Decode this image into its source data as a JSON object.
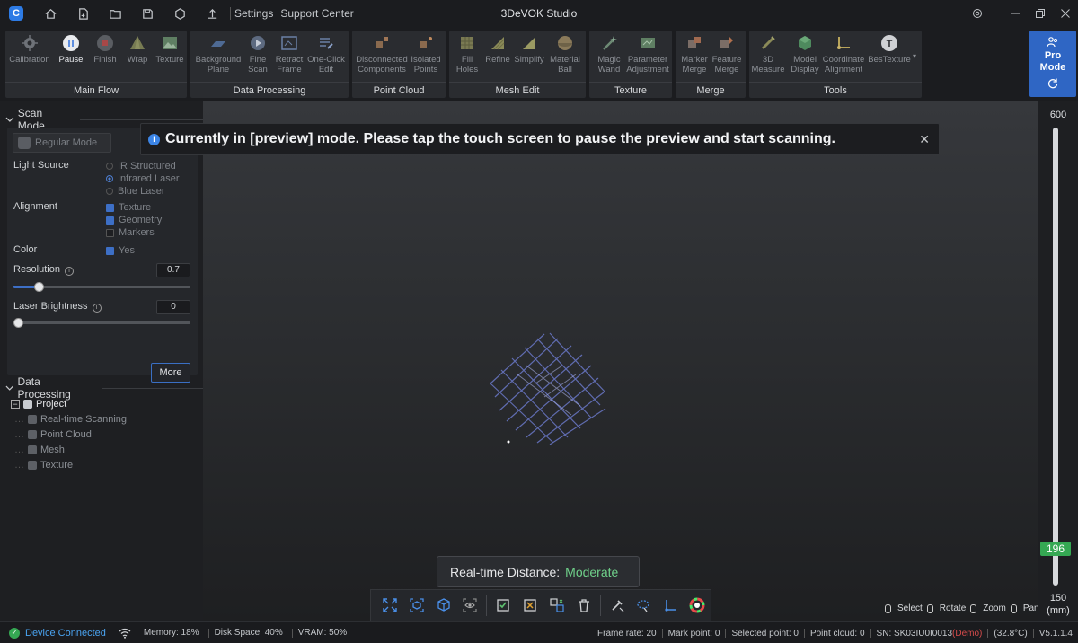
{
  "titlebar": {
    "logo_letter": "C",
    "links": [
      "Settings",
      "Support Center"
    ],
    "app_title": "3DeVOK Studio"
  },
  "ribbon": {
    "groups": [
      {
        "label": "Main Flow",
        "tools": [
          {
            "label": "Calibration",
            "icon": "calibration-icon",
            "active": false
          },
          {
            "label": "Pause",
            "icon": "pause-icon",
            "active": true
          },
          {
            "label": "Finish",
            "icon": "stop-icon",
            "active": false
          },
          {
            "label": "Wrap",
            "icon": "wrap-icon",
            "active": false
          },
          {
            "label": "Texture",
            "icon": "image-icon",
            "active": false
          }
        ]
      },
      {
        "label": "Data Processing",
        "tools": [
          {
            "label": "Background Plane",
            "icon": "plane-icon"
          },
          {
            "label": "Fine Scan",
            "icon": "play-scan-icon"
          },
          {
            "label": "Retract Frame",
            "icon": "frame-icon"
          },
          {
            "label": "One-Click Edit",
            "icon": "edit-list-icon"
          }
        ]
      },
      {
        "label": "Point Cloud",
        "tools": [
          {
            "label": "Disconnected Components",
            "icon": "components-icon"
          },
          {
            "label": "Isolated Points",
            "icon": "isolated-points-icon"
          }
        ]
      },
      {
        "label": "Mesh Edit",
        "tools": [
          {
            "label": "Fill Holes",
            "icon": "fill-holes-icon"
          },
          {
            "label": "Refine",
            "icon": "refine-icon"
          },
          {
            "label": "Simplify",
            "icon": "simplify-icon"
          },
          {
            "label": "Material Ball",
            "icon": "material-ball-icon"
          }
        ]
      },
      {
        "label": "Texture",
        "tools": [
          {
            "label": "Magic Wand",
            "icon": "magic-wand-icon"
          },
          {
            "label": "Parameter Adjustment",
            "icon": "parameter-icon"
          }
        ]
      },
      {
        "label": "Merge",
        "tools": [
          {
            "label": "Marker Merge",
            "icon": "marker-merge-icon"
          },
          {
            "label": "Feature Merge",
            "icon": "feature-merge-icon"
          }
        ]
      },
      {
        "label": "Tools",
        "tools": [
          {
            "label": "3D Measure",
            "icon": "measure-icon"
          },
          {
            "label": "Model Display",
            "icon": "model-display-icon"
          },
          {
            "label": "Coordinate Alignment",
            "icon": "coordinate-icon"
          },
          {
            "label": "BesTexture",
            "icon": "bestexture-icon"
          }
        ]
      }
    ],
    "pro_mode": {
      "line1": "Pro",
      "line2": "Mode"
    }
  },
  "scan_mode": {
    "header": "Scan Mode",
    "mode_button": "Regular Mode",
    "light_source": {
      "label": "Light Source",
      "options": [
        "IR Structured",
        "Infrared Laser",
        "Blue Laser"
      ],
      "selected": "Infrared Laser"
    },
    "alignment": {
      "label": "Alignment",
      "options": [
        {
          "label": "Texture",
          "checked": true
        },
        {
          "label": "Geometry",
          "checked": true
        },
        {
          "label": "Markers",
          "checked": false
        }
      ]
    },
    "color": {
      "label": "Color",
      "option": "Yes",
      "checked": true
    },
    "resolution": {
      "label": "Resolution",
      "value": "0.7",
      "level": 0.14
    },
    "laser_brightness": {
      "label": "Laser Brightness",
      "value": "0",
      "level": 0.0
    },
    "more_button": "More"
  },
  "data_processing": {
    "header": "Data Processing",
    "tree": [
      {
        "label": "Project",
        "depth": 0
      },
      {
        "label": "Real-time Scanning",
        "depth": 1
      },
      {
        "label": "Point Cloud",
        "depth": 1
      },
      {
        "label": "Mesh",
        "depth": 1
      },
      {
        "label": "Texture",
        "depth": 1
      }
    ]
  },
  "viewport": {
    "toast_message": "Currently in [preview] mode. Please tap the touch screen to pause the preview and start scanning.",
    "distance_label": "Real-time Distance:",
    "distance_value": "Moderate",
    "mouse_legend": [
      "Select",
      "Rotate",
      "Zoom",
      "Pan"
    ]
  },
  "depth": {
    "max": "600",
    "current": "196",
    "min": "150",
    "unit": "(mm)"
  },
  "status": {
    "connection": "Device Connected",
    "memory": "Memory:  18%",
    "disk": "Disk Space:  40%",
    "vram": "VRAM:  50%",
    "frame_rate": "Frame rate: 20",
    "mark_point": "Mark point: 0",
    "selected_point": "Selected point: 0",
    "point_cloud": "Point cloud: 0",
    "sn": "SN: SK03IU0I0013",
    "demo": "(Demo)",
    "temp": "(32.8°C)",
    "version": "V5.1.1.4"
  },
  "colors": {
    "accent": "#2f66c4",
    "ok": "#35a853",
    "moderate": "#6fd08a",
    "demo": "#d64b4b"
  }
}
